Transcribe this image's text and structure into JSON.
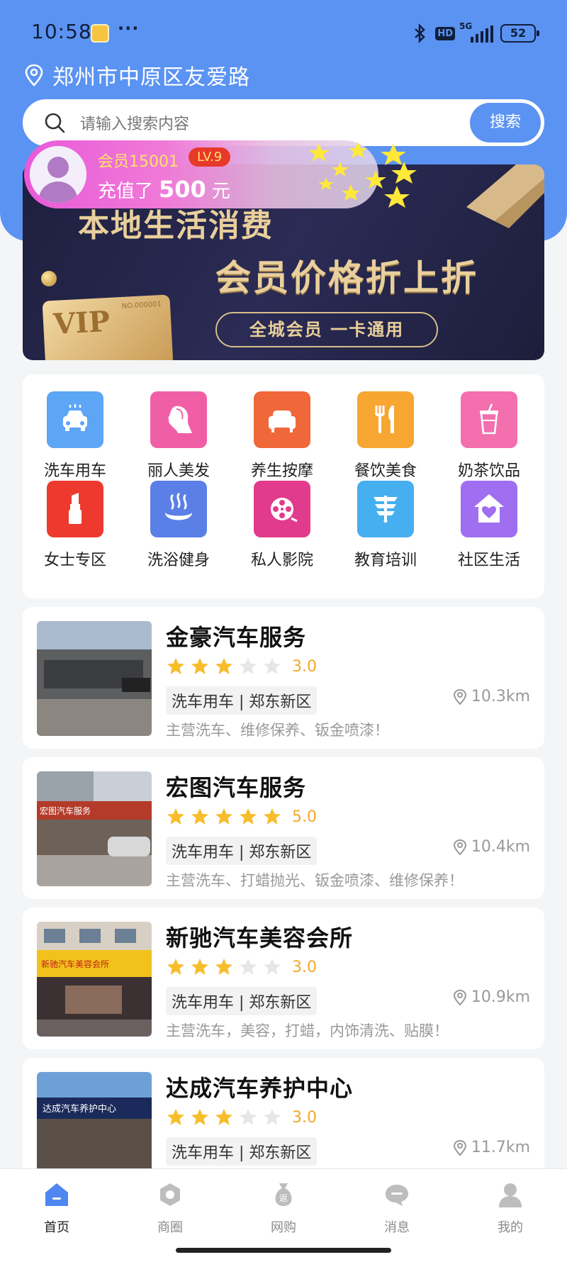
{
  "status_bar": {
    "time": "10:58",
    "dots": "···",
    "hd": "HD",
    "network": "5G",
    "battery": "52"
  },
  "location": {
    "text": "郑州市中原区友爱路"
  },
  "search": {
    "placeholder": "请输入搜索内容",
    "button": "搜索"
  },
  "member_toast": {
    "name": "会员15001",
    "level": "LV.9",
    "recharge_prefix": "充值了",
    "amount": "500",
    "unit": "元"
  },
  "banner": {
    "line1": "本地生活消费",
    "line2": "会员价格折上折",
    "pill": "全城会员 一卡通用",
    "vip": "VIP",
    "vip_no": "NO.000001"
  },
  "categories": [
    {
      "label": "洗车用车",
      "icon": "car-icon",
      "color": "#5da5f5"
    },
    {
      "label": "丽人美发",
      "icon": "woman-profile-icon",
      "color": "#f05fa6"
    },
    {
      "label": "养生按摩",
      "icon": "sofa-icon",
      "color": "#f0673a"
    },
    {
      "label": "餐饮美食",
      "icon": "fork-knife-icon",
      "color": "#f7a632"
    },
    {
      "label": "奶茶饮品",
      "icon": "milk-tea-icon",
      "color": "#f36fae"
    },
    {
      "label": "女士专区",
      "icon": "lipstick-icon",
      "color": "#ee3a2e"
    },
    {
      "label": "洗浴健身",
      "icon": "hot-spring-icon",
      "color": "#5a7fe6"
    },
    {
      "label": "私人影院",
      "icon": "film-reel-icon",
      "color": "#e23a8c"
    },
    {
      "label": "教育培训",
      "icon": "education-icon",
      "color": "#46aff0"
    },
    {
      "label": "社区生活",
      "icon": "house-heart-icon",
      "color": "#a06ef0"
    }
  ],
  "shops": [
    {
      "name": "金豪汽车服务",
      "rating": 3,
      "rating_text": "3.0",
      "tag": "洗车用车 | 郑东新区",
      "distance": "10.3km",
      "desc": "主营洗车、维修保养、钣金喷漆！",
      "sign": ""
    },
    {
      "name": "宏图汽车服务",
      "rating": 5,
      "rating_text": "5.0",
      "tag": "洗车用车 | 郑东新区",
      "distance": "10.4km",
      "desc": "主营洗车、打蜡抛光、钣金喷漆、维修保养！",
      "sign": "宏图汽车服务"
    },
    {
      "name": "新驰汽车美容会所",
      "rating": 3,
      "rating_text": "3.0",
      "tag": "洗车用车 | 郑东新区",
      "distance": "10.9km",
      "desc": "主营洗车，美容，打蜡，内饰清洗、贴膜！",
      "sign": "新驰汽车美容会所"
    },
    {
      "name": "达成汽车养护中心",
      "rating": 3,
      "rating_text": "3.0",
      "tag": "洗车用车 | 郑东新区",
      "distance": "11.7km",
      "desc": "",
      "sign": "达成汽车养护中心"
    }
  ],
  "nav": [
    {
      "label": "首页",
      "icon": "home-icon",
      "active": true
    },
    {
      "label": "商圈",
      "icon": "shop-circle-icon",
      "active": false
    },
    {
      "label": "网购",
      "icon": "money-bag-icon",
      "active": false
    },
    {
      "label": "消息",
      "icon": "message-icon",
      "active": false
    },
    {
      "label": "我的",
      "icon": "user-icon",
      "active": false
    }
  ],
  "colors": {
    "primary": "#5b93f2",
    "star": "#f7bd2a",
    "star_empty": "#e6e6e6"
  }
}
